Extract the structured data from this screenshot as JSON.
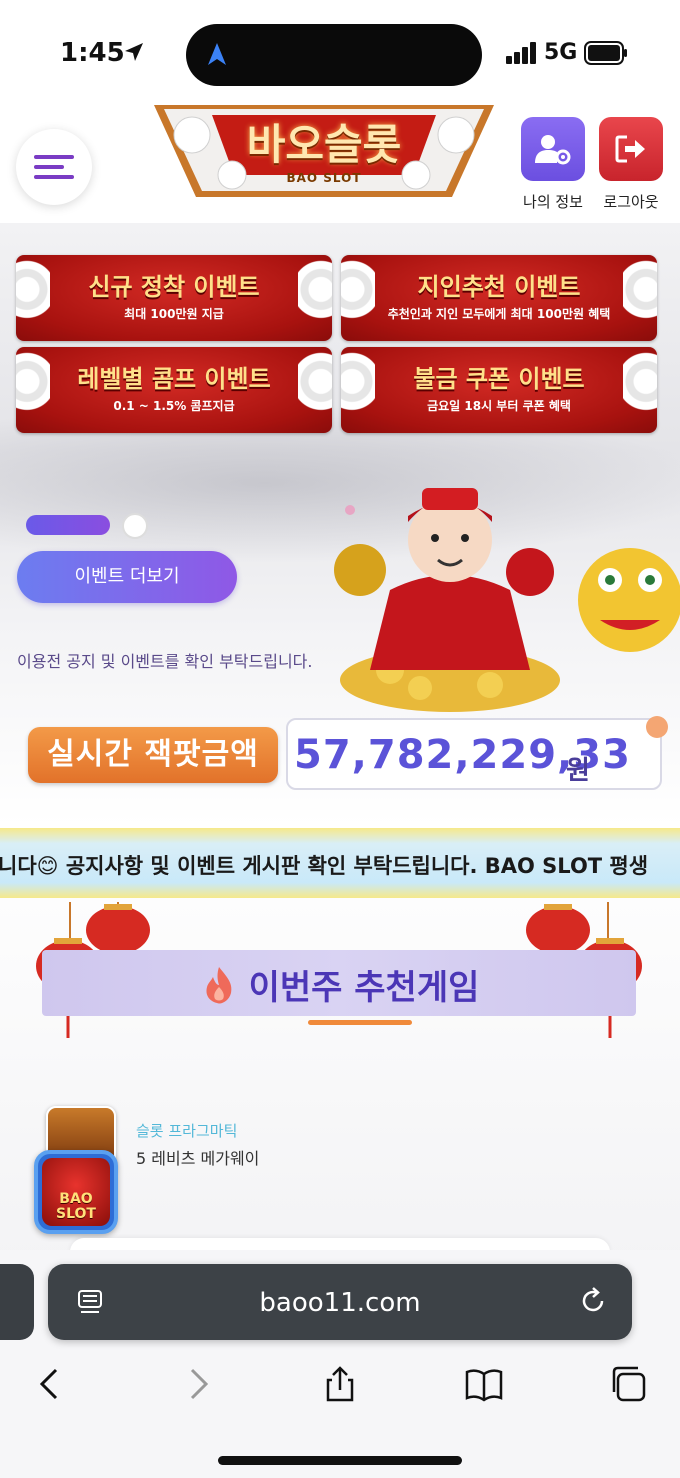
{
  "status": {
    "time": "1:45",
    "network": "5G"
  },
  "header": {
    "logo_text": "바오슬롯",
    "logo_sub": "BAO SLOT",
    "my_info_label": "나의 정보",
    "logout_label": "로그아웃"
  },
  "events": [
    {
      "title": "신규 정착 이벤트",
      "subtitle": "최대 100만원 지급"
    },
    {
      "title": "지인추천 이벤트",
      "subtitle": "추천인과 지인 모두에게 최대 100만원 혜택"
    },
    {
      "title": "레벨별 콤프 이벤트",
      "subtitle": "0.1 ~ 1.5% 콤프지급"
    },
    {
      "title": "불금 쿠폰 이벤트",
      "subtitle": "금요일 18시 부터 쿠폰 혜택"
    }
  ],
  "more_events_label": "이벤트 더보기",
  "notice_text": "이용전 공지 및 이벤트를 확인 부탁드립니다.",
  "jackpot": {
    "label": "실시간 잭팟금액",
    "amount": "57,782,229,33",
    "currency": "원"
  },
  "marquee_text": "니다😊 공지사항 및 이벤트 게시판 확인 부탁드립니다. BAO SLOT 평생",
  "recommended_title": "이번주 추천게임",
  "game": {
    "category": "슬롯 프라그마틱",
    "name": "5 레비츠 메가웨이"
  },
  "floating_logo_text": "BAO SLOT",
  "browser": {
    "url": "baoo11.com"
  },
  "colors": {
    "accent_purple": "#6b4fe0",
    "logout_red": "#c8242c",
    "jackpot_orange": "#e2722a",
    "banner_red": "#a8120f"
  },
  "icons": {
    "menu": "hamburger-icon",
    "my_info": "user-settings-icon",
    "logout": "logout-icon",
    "reload": "reload-icon"
  }
}
